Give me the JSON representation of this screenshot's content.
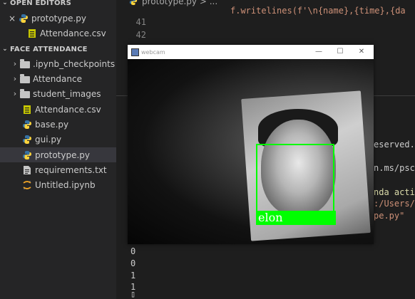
{
  "explorer": {
    "open_editors_header": "OPEN EDITORS",
    "open_editors": [
      {
        "label": "prototype.py",
        "icon": "python-icon",
        "close": "×"
      },
      {
        "label": "Attendance.csv",
        "icon": "csv-icon"
      }
    ],
    "project_header": "FACE ATTENDANCE",
    "items": [
      {
        "label": ".ipynb_checkpoints",
        "type": "folder"
      },
      {
        "label": "Attendance",
        "type": "folder"
      },
      {
        "label": "student_images",
        "type": "folder"
      },
      {
        "label": "Attendance.csv",
        "type": "csv"
      },
      {
        "label": "base.py",
        "type": "python"
      },
      {
        "label": "gui.py",
        "type": "python"
      },
      {
        "label": "prototype.py",
        "type": "python",
        "selected": true
      },
      {
        "label": "requirements.txt",
        "type": "text"
      },
      {
        "label": "Untitled.ipynb",
        "type": "notebook"
      }
    ]
  },
  "editor": {
    "breadcrumb": "prototype.py > ...",
    "line_numbers": [
      "41",
      "42"
    ],
    "partial_code": "f.writelines(f'\\n{name},{time},{da"
  },
  "terminal": {
    "partial_lines": [
      "eserved.",
      "n.ms/psco",
      "nda activ",
      ":/Users/",
      "pe.py\""
    ],
    "output_lines": [
      "0",
      "0",
      "1",
      "1"
    ],
    "cursor": "▯"
  },
  "webcam_window": {
    "title": "webcam",
    "minimize": "—",
    "maximize": "☐",
    "close": "✕",
    "detected_name": "elon"
  },
  "colors": {
    "box": "#00ff00",
    "python_blue": "#3572a5",
    "python_yellow": "#ffd43b",
    "csv": "#c6c600",
    "string": "#ce9178",
    "keyword": "#dcdcaa"
  }
}
